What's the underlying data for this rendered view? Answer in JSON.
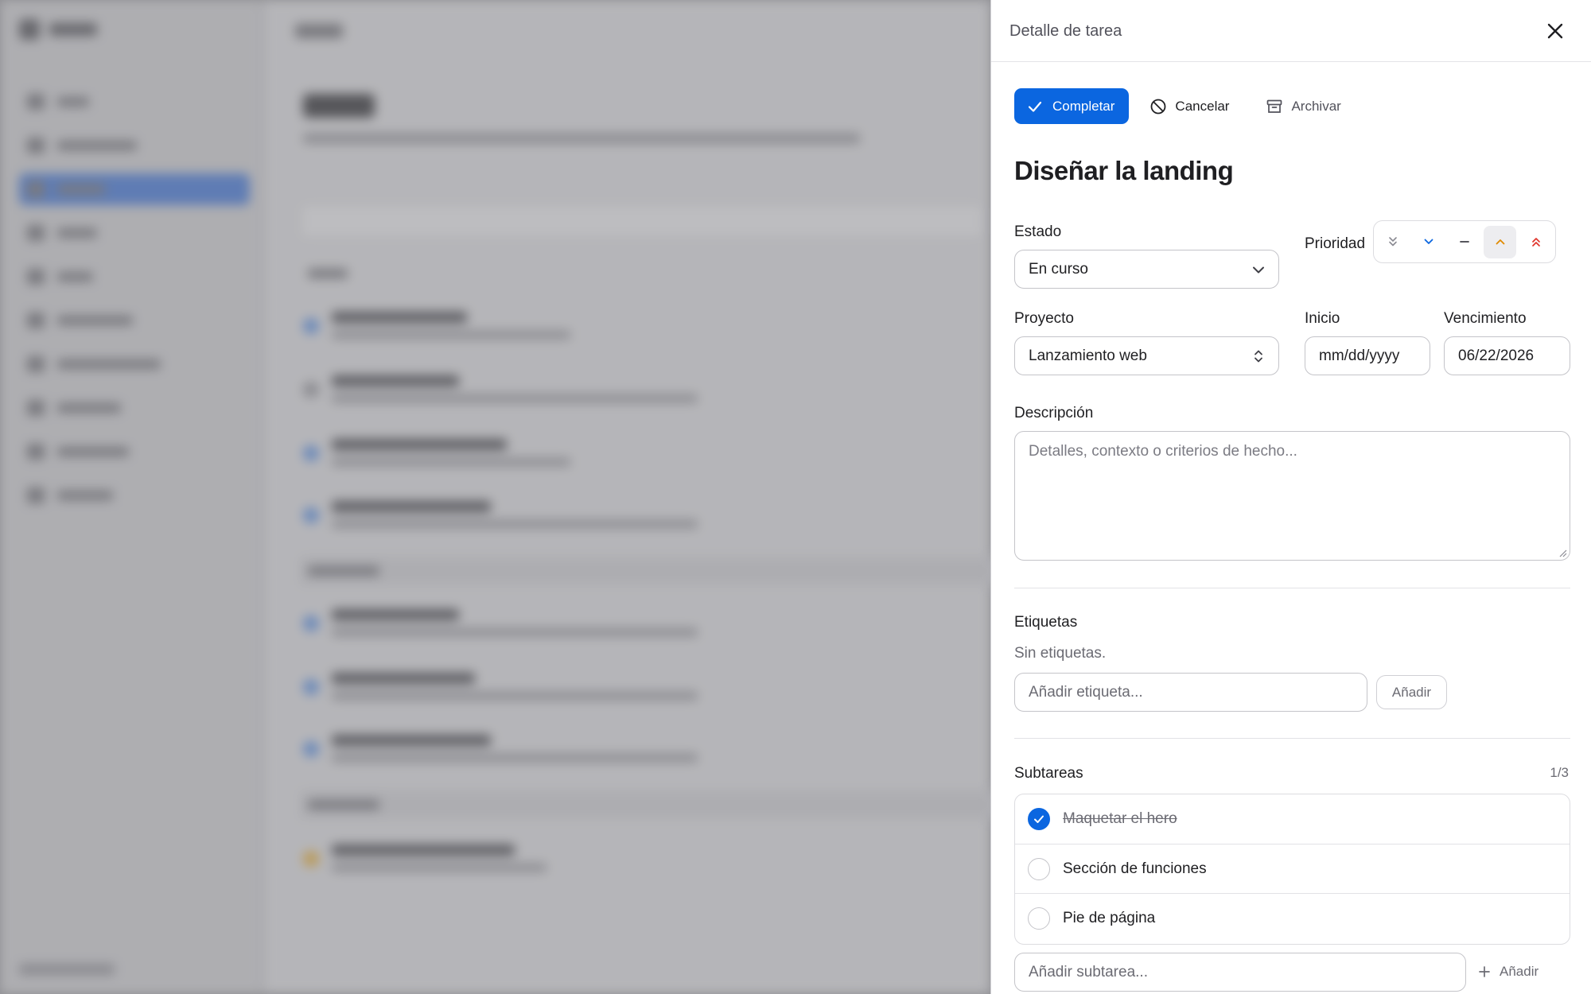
{
  "drawer": {
    "title": "Detalle de tarea",
    "close_icon": "close-icon"
  },
  "actions": {
    "complete_label": "Completar",
    "cancel_label": "Cancelar",
    "archive_label": "Archivar"
  },
  "task": {
    "title": "Diseñar la landing"
  },
  "fields": {
    "status_label": "Estado",
    "status_value": "En curso",
    "priority_label": "Prioridad",
    "priority_options": [
      "lowest",
      "low",
      "medium",
      "high",
      "highest"
    ],
    "priority_selected": "high",
    "project_label": "Proyecto",
    "project_value": "Lanzamiento web",
    "start_label": "Inicio",
    "start_value": "mm/dd/yyyy",
    "due_label": "Vencimiento",
    "due_value": "06/22/2026",
    "description_label": "Descripción",
    "description_placeholder": "Detalles, contexto o criterios de hecho..."
  },
  "tags": {
    "label": "Etiquetas",
    "empty_text": "Sin etiquetas.",
    "input_placeholder": "Añadir etiqueta...",
    "add_label": "Añadir"
  },
  "subtasks": {
    "label": "Subtareas",
    "count": "1/3",
    "items": [
      {
        "label": "Maquetar el hero",
        "done": true
      },
      {
        "label": "Sección de funciones",
        "done": false
      },
      {
        "label": "Pie de página",
        "done": false
      }
    ],
    "input_placeholder": "Añadir subtarea...",
    "add_label": "Añadir"
  },
  "colors": {
    "primary": "#0b66e0",
    "priority_low": "#0b66e0",
    "priority_high": "#e08a00",
    "priority_highest": "#e0342b",
    "overlay": "#8e8e92"
  }
}
